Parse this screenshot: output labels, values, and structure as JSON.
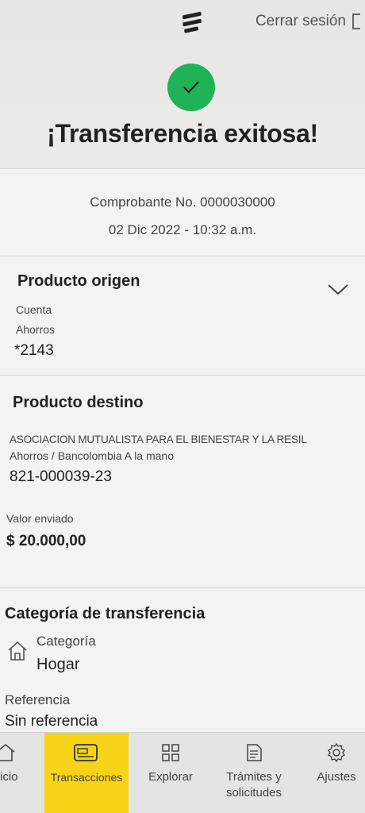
{
  "header": {
    "logo_icon": "bancolombia-logo-icon",
    "logout_label": "Cerrar sesión",
    "logout_icon": "logout-icon"
  },
  "status": {
    "icon": "check-circle-icon",
    "title": "¡Transferencia exitosa!",
    "accent_color": "#1fb257"
  },
  "voucher": {
    "number": "Comprobante No. 0000030000",
    "datetime": "02 Dic 2022 - 10:32 a.m."
  },
  "origin": {
    "title": "Producto origen",
    "account_label": "Cuenta",
    "account_type": "Ahorros",
    "account_number": "*2143"
  },
  "destination": {
    "title": "Producto destino",
    "name": "ASOCIACION MUTUALISTA PARA EL BIENESTAR Y LA RESIL",
    "account_type": "Ahorros / Bancolombia A la mano",
    "account_number": "821-000039-23",
    "amount_label": "Valor enviado",
    "amount": "$ 20.000,00"
  },
  "category": {
    "title": "Categoría de transferencia",
    "label": "Categoría",
    "value": "Hogar",
    "icon": "home-icon",
    "reference_label": "Referencia",
    "reference_value": "Sin referencia"
  },
  "nav": {
    "items": [
      {
        "label": "icio",
        "icon": "home-icon"
      },
      {
        "label": "Transacciones",
        "icon": "wallet-card-icon",
        "active": true
      },
      {
        "label": "Explorar",
        "icon": "grid-icon"
      },
      {
        "label": "Trámites y solicitudes",
        "icon": "document-icon"
      },
      {
        "label": "Ajustes",
        "icon": "gear-icon"
      }
    ],
    "active_color": "#f7d417"
  }
}
